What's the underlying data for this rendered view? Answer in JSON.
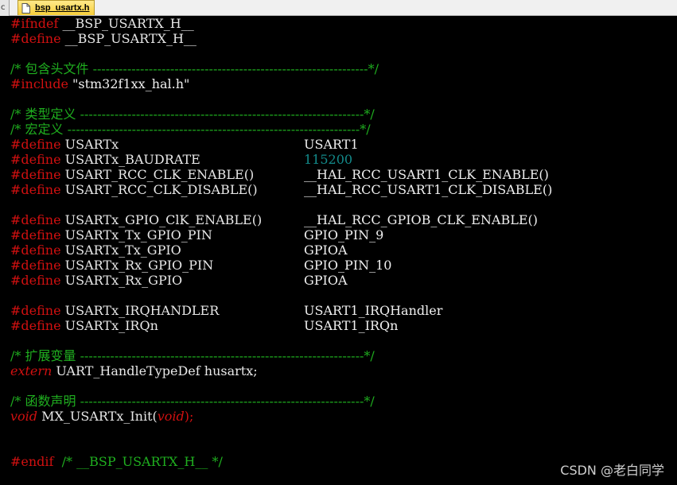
{
  "tab": {
    "left_edge": "c",
    "file_name": "bsp_usartx.h"
  },
  "code": {
    "l1": {
      "pp": "#ifndef",
      "rest": " __BSP_USARTX_H__"
    },
    "l2": {
      "pp": "#define",
      "rest": " __BSP_USARTX_H__"
    },
    "l4": {
      "comment": "/* 包含头文件 ----------------------------------------------------------------*/"
    },
    "l5": {
      "pp": "#include",
      "rest": " \"stm32f1xx_hal.h\""
    },
    "l7": {
      "comment": "/* 类型定义 ------------------------------------------------------------------*/"
    },
    "l8": {
      "comment": "/* 宏定义 --------------------------------------------------------------------*/"
    },
    "defines_block1": [
      {
        "pp": "#define",
        "name": " USARTx",
        "value": "USART1",
        "value_type": "id"
      },
      {
        "pp": "#define",
        "name": " USARTx_BAUDRATE",
        "value": "115200",
        "value_type": "num"
      },
      {
        "pp": "#define",
        "name": " USART_RCC_CLK_ENABLE()",
        "value": "__HAL_RCC_USART1_CLK_ENABLE()",
        "value_type": "id"
      },
      {
        "pp": "#define",
        "name": " USART_RCC_CLK_DISABLE()",
        "value": "__HAL_RCC_USART1_CLK_DISABLE()",
        "value_type": "id"
      }
    ],
    "defines_block2": [
      {
        "pp": "#define",
        "name": " USARTx_GPIO_ClK_ENABLE()",
        "value": "__HAL_RCC_GPIOB_CLK_ENABLE()",
        "value_type": "id"
      },
      {
        "pp": "#define",
        "name": " USARTx_Tx_GPIO_PIN",
        "value": "GPIO_PIN_9",
        "value_type": "id"
      },
      {
        "pp": "#define",
        "name": " USARTx_Tx_GPIO",
        "value": "GPIOA",
        "value_type": "id"
      },
      {
        "pp": "#define",
        "name": " USARTx_Rx_GPIO_PIN",
        "value": "GPIO_PIN_10",
        "value_type": "id"
      },
      {
        "pp": "#define",
        "name": " USARTx_Rx_GPIO",
        "value": "GPIOA",
        "value_type": "id"
      }
    ],
    "defines_block3": [
      {
        "pp": "#define",
        "name": " USARTx_IRQHANDLER",
        "value": "USART1_IRQHandler",
        "value_type": "id"
      },
      {
        "pp": "#define",
        "name": " USARTx_IRQn",
        "value": "USART1_IRQn",
        "value_type": "id"
      }
    ],
    "l22": {
      "comment": "/* 扩展变量 ------------------------------------------------------------------*/"
    },
    "l23": {
      "kw": "extern",
      "rest": " UART_HandleTypeDef husartx;"
    },
    "l25": {
      "comment": "/* 函数声明 ------------------------------------------------------------------*/"
    },
    "l26": {
      "kw": "void",
      "mid": " MX_USARTx_Init(",
      "kw2": "void",
      "end": ");"
    },
    "l29": {
      "pp": "#endif",
      "gap": "  ",
      "comment": "/* __BSP_USARTX_H__ */"
    }
  },
  "watermark": "CSDN @老白同学",
  "colors": {
    "background": "#000000",
    "preprocessor": "#d01010",
    "comment": "#1fae1f",
    "number": "#138a8a",
    "identifier": "#f0f0f0",
    "tab_active": "#f7cf3a"
  }
}
